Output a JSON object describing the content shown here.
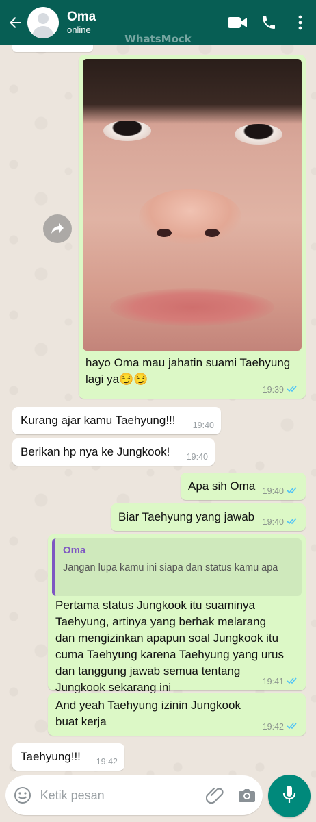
{
  "header": {
    "contact_name": "Oma",
    "status": "online",
    "watermark": "WhatsMock"
  },
  "messages": [
    {
      "direction": "out",
      "type": "image",
      "caption": "hayo Oma mau jahatin suami Taehyung lagi ya😏😏",
      "time": "19:39",
      "ticks": "read"
    },
    {
      "direction": "in",
      "text": "Kurang ajar kamu Taehyung!!!",
      "time": "19:40"
    },
    {
      "direction": "in",
      "text": "Berikan hp nya ke Jungkook!",
      "time": "19:40"
    },
    {
      "direction": "out",
      "text": "Apa sih Oma",
      "time": "19:40",
      "ticks": "read"
    },
    {
      "direction": "out",
      "text": "Biar Taehyung yang jawab",
      "time": "19:40",
      "ticks": "read"
    },
    {
      "direction": "out",
      "quote_author": "Oma",
      "quote_text": "Jangan lupa kamu ini siapa dan status kamu apa",
      "text": "Pertama status Jungkook itu suaminya Taehyung, artinya yang berhak melarang dan mengizinkan apapun soal Jungkook itu cuma Taehyung karena Taehyung yang urus dan tanggung jawab semua tentang Jungkook sekarang ini",
      "time": "19:41",
      "ticks": "read"
    },
    {
      "direction": "out",
      "text": "And yeah Taehyung izinin Jungkook buat kerja",
      "time": "19:42",
      "ticks": "read"
    },
    {
      "direction": "in",
      "text": "Taehyung!!!",
      "time": "19:42"
    }
  ],
  "composer": {
    "placeholder": "Ketik pesan"
  },
  "colors": {
    "header": "#075e54",
    "outgoing_bubble": "#dcf8c6",
    "incoming_bubble": "#ffffff",
    "read_tick": "#4fc3f7",
    "mic_button": "#00897b"
  },
  "icons": [
    "back-arrow-icon",
    "video-call-icon",
    "phone-icon",
    "more-vert-icon",
    "forward-icon",
    "emoji-icon",
    "attach-icon",
    "camera-icon",
    "mic-icon"
  ]
}
